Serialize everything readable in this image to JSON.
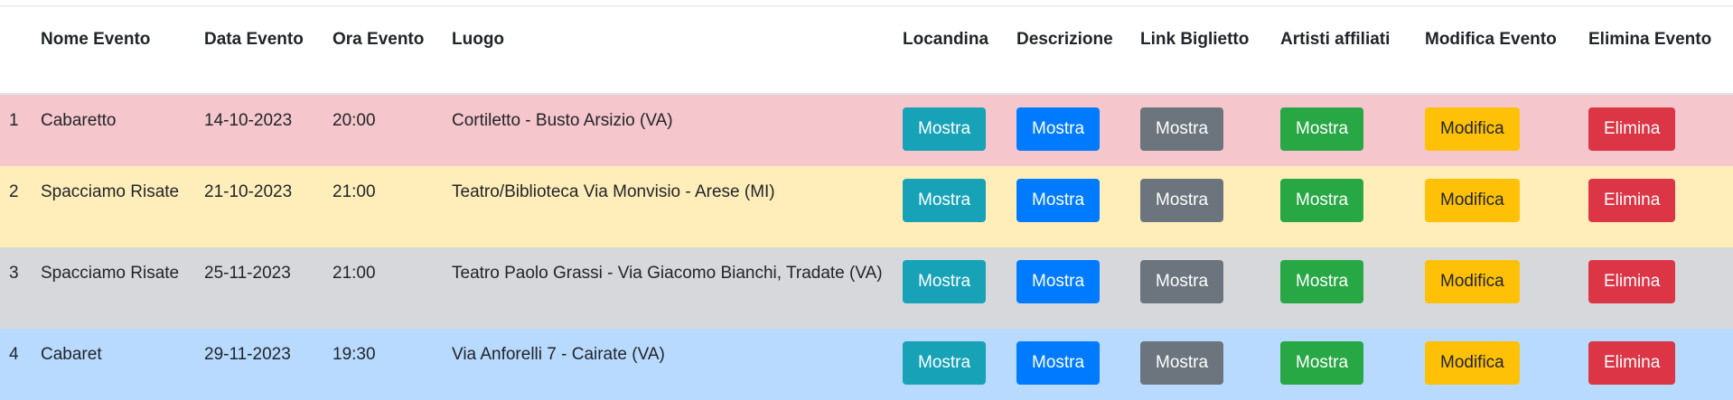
{
  "table": {
    "headers": {
      "num": "",
      "nome": "Nome Evento",
      "data": "Data Evento",
      "ora": "Ora Evento",
      "luogo": "Luogo",
      "locandina": "Locandina",
      "descrizione": "Descrizione",
      "link": "Link Biglietto",
      "artisti": "Artisti affiliati",
      "modifica": "Modifica Evento",
      "elimina": "Elimina Evento"
    },
    "buttons": {
      "show": "Mostra",
      "edit": "Modifica",
      "delete": "Elimina"
    },
    "rows": [
      {
        "num": "1",
        "nome": "Cabaretto",
        "data": "14-10-2023",
        "ora": "20:00",
        "luogo": "Cortiletto - Busto Arsizio (VA)"
      },
      {
        "num": "2",
        "nome": "Spacciamo Risate",
        "data": "21-10-2023",
        "ora": "21:00",
        "luogo": "Teatro/Biblioteca Via Monvisio - Arese (MI)"
      },
      {
        "num": "3",
        "nome": "Spacciamo Risate",
        "data": "25-11-2023",
        "ora": "21:00",
        "luogo": "Teatro Paolo Grassi - Via Giacomo Bianchi, Tradate (VA)"
      },
      {
        "num": "4",
        "nome": "Cabaret",
        "data": "29-11-2023",
        "ora": "19:30",
        "luogo": "Via Anforelli 7 - Cairate (VA)"
      }
    ]
  },
  "colors": {
    "row_1": "#f5c6cb",
    "row_2": "#ffeeba",
    "row_3": "#d6d8db",
    "row_4": "#b8daff",
    "btn_locandina": "#17a2b8",
    "btn_descrizione": "#007bff",
    "btn_link": "#6c757d",
    "btn_artisti": "#28a745",
    "btn_modifica": "#ffc107",
    "btn_elimina": "#dc3545"
  }
}
